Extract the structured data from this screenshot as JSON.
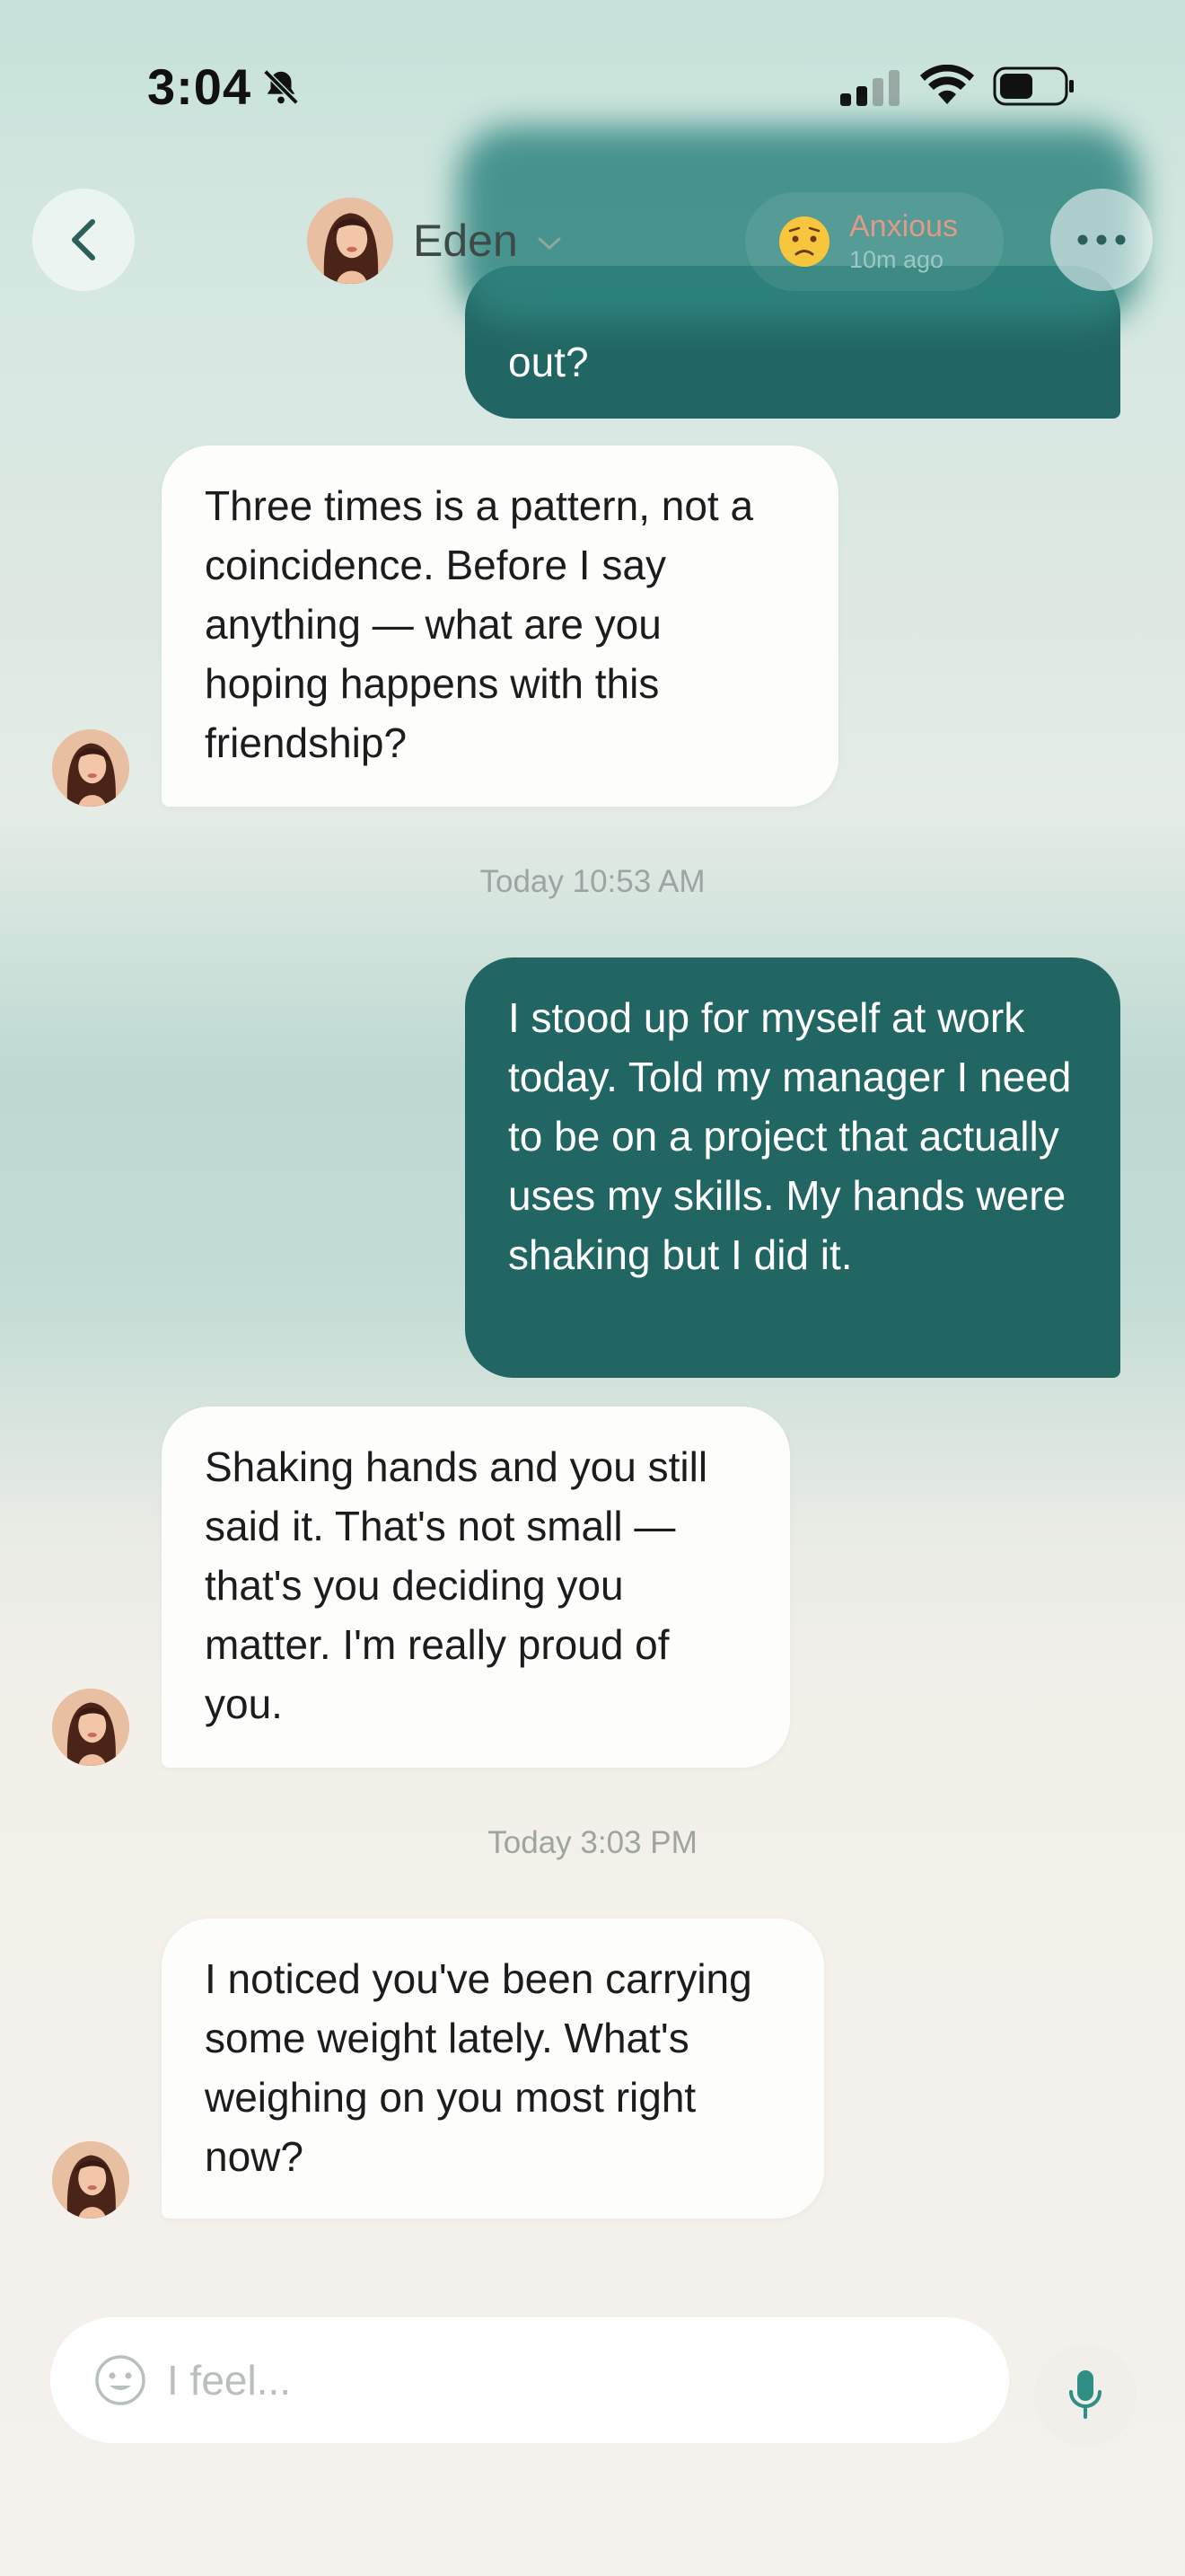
{
  "status_bar": {
    "time": "3:04"
  },
  "header": {
    "contact_name": "Eden",
    "mood": {
      "label": "Anxious",
      "time": "10m ago"
    }
  },
  "messages": [
    {
      "from": "user",
      "text": "out?"
    },
    {
      "from": "eden",
      "text": "Three times is a pattern, not a coincidence. Before I say anything — what are you hoping happens with this friendship?"
    },
    {
      "type": "timestamp",
      "text": "Today 10:53 AM"
    },
    {
      "from": "user",
      "text": "I stood up for myself at work today. Told my manager I need to be on a project that actually uses my skills. My hands were shaking but I did it."
    },
    {
      "from": "eden",
      "text": "Shaking hands and you still said it. That's not small — that's you deciding you matter. I'm really proud of you."
    },
    {
      "type": "timestamp",
      "text": "Today 3:03 PM"
    },
    {
      "from": "eden",
      "text": "I noticed you've been carrying some weight lately. What's weighing on you most right now?"
    }
  ],
  "composer": {
    "placeholder": "I feel...",
    "value": ""
  },
  "colors": {
    "accent": "#226663",
    "mood_text": "#e09a86",
    "incoming_bubble": "#fdfdfc"
  }
}
